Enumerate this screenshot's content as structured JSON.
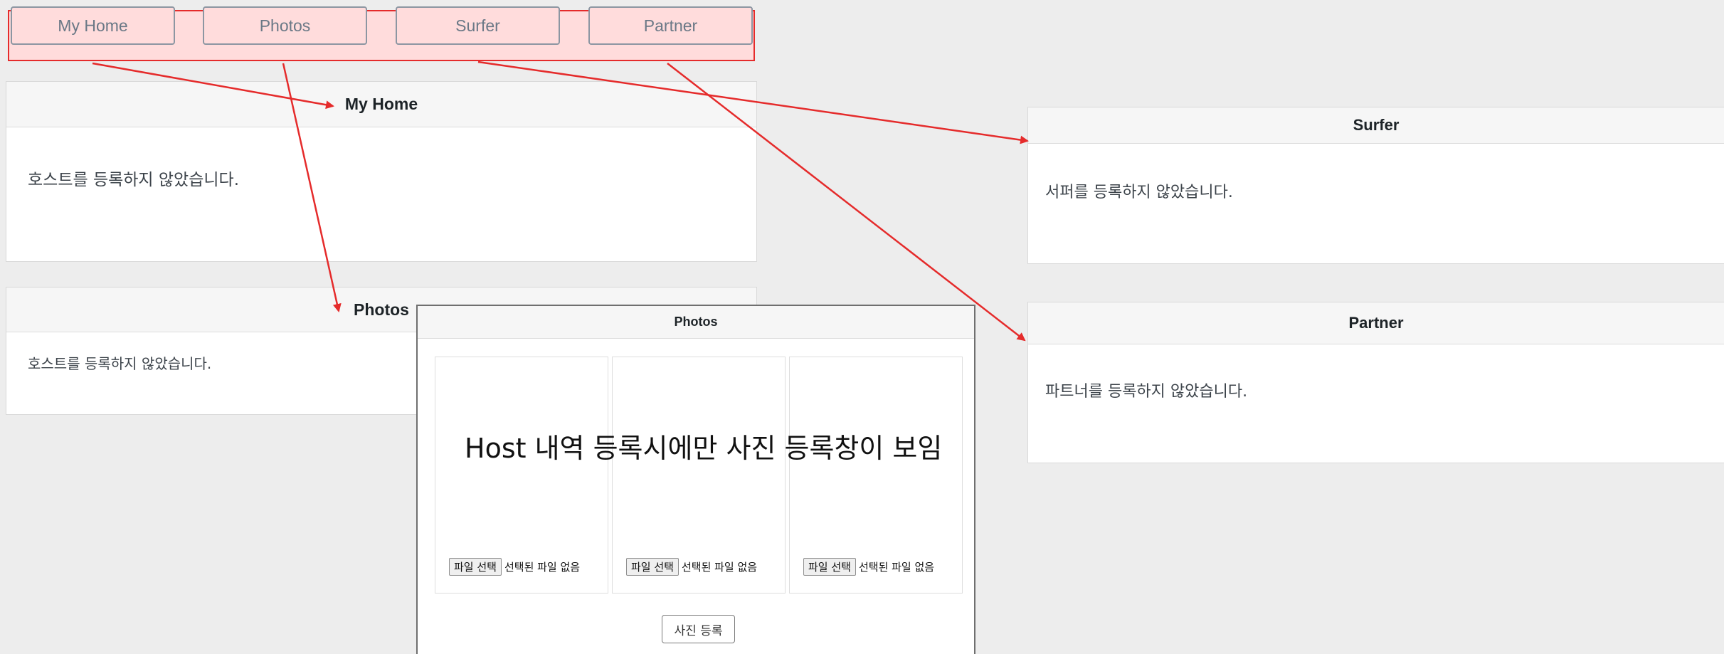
{
  "tabs": [
    {
      "label": "My Home"
    },
    {
      "label": "Photos"
    },
    {
      "label": "Surfer"
    },
    {
      "label": "Partner"
    }
  ],
  "panels": {
    "my_home": {
      "title": "My Home",
      "message": "호스트를 등록하지 않았습니다."
    },
    "photos": {
      "title": "Photos",
      "message": "호스트를 등록하지 않았습니다."
    },
    "surfer": {
      "title": "Surfer",
      "message": "서퍼를 등록하지 않았습니다."
    },
    "partner": {
      "title": "Partner",
      "message": "파트너를 등록하지 않았습니다."
    }
  },
  "photos_modal": {
    "title": "Photos",
    "annotation": "Host 내역 등록시에만 사진 등록창이 보임",
    "uploads": [
      {
        "button": "파일 선택",
        "status": "선택된 파일 없음"
      },
      {
        "button": "파일 선택",
        "status": "선택된 파일 없음"
      },
      {
        "button": "파일 선택",
        "status": "선택된 파일 없음"
      }
    ],
    "submit_label": "사진 등록"
  },
  "colors": {
    "tab_highlight": "#ffdcdc",
    "annotation_red": "#e52b2b",
    "page_bg": "#ededed"
  }
}
